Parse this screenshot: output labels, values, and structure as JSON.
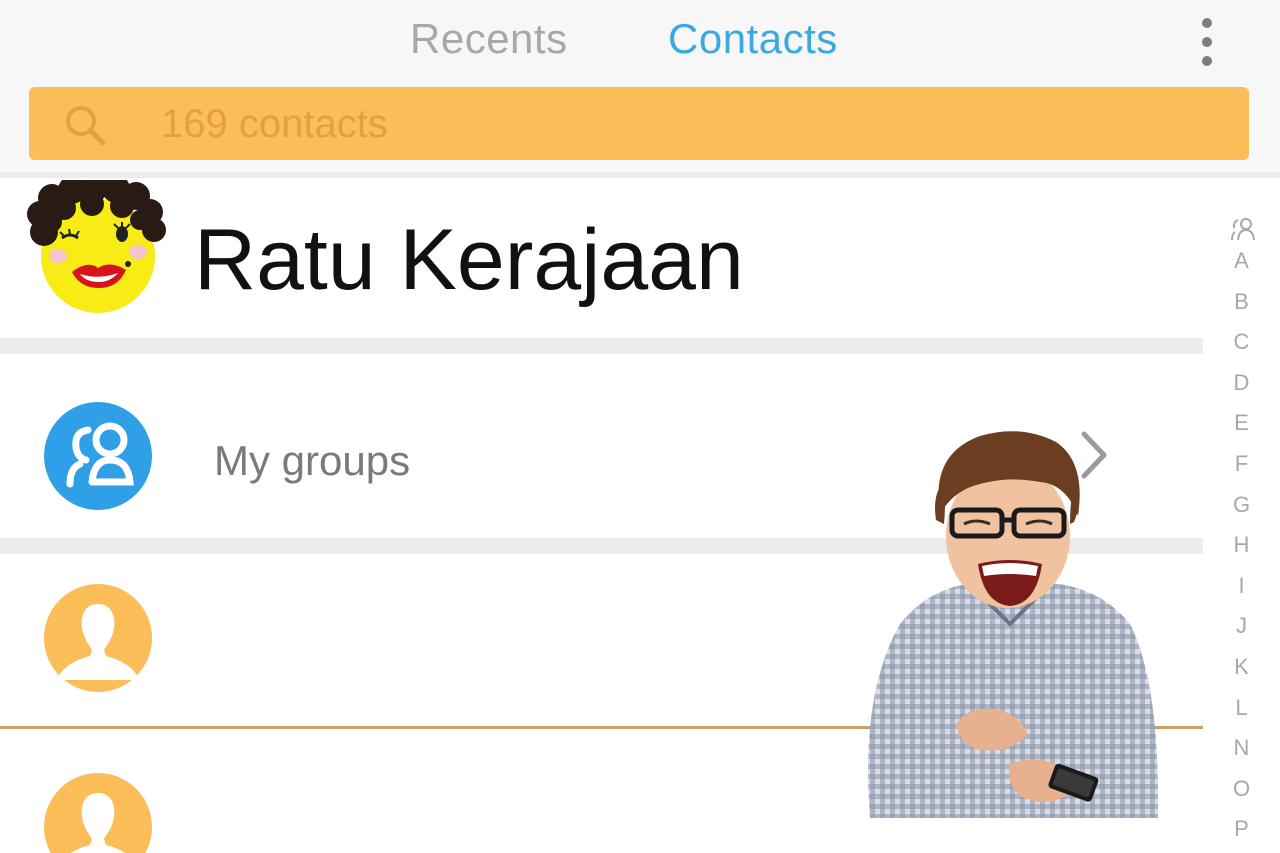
{
  "tabs": {
    "recents": "Recents",
    "contacts": "Contacts",
    "active": "Contacts",
    "active_color": "#3aa9e2",
    "inactive_color": "#a8a8a8"
  },
  "menu_icon": "more-vertical-icon",
  "search": {
    "placeholder": "169 contacts",
    "icon": "search-icon",
    "bar_color": "#fbbd57"
  },
  "profile": {
    "name": "Ratu Kerajaan",
    "avatar": "cartoon-face-avatar"
  },
  "groups": {
    "label": "My groups",
    "icon": "groups-icon",
    "icon_color": "#2f9fe8",
    "chevron": "chevron-right-icon"
  },
  "contacts": [
    {
      "avatar": "person-placeholder-icon",
      "color": "#fbbd57"
    },
    {
      "avatar": "person-placeholder-icon",
      "color": "#fbbd57"
    }
  ],
  "alphabet_index": {
    "groups_icon": "groups-small-icon",
    "letters": [
      "A",
      "B",
      "C",
      "D",
      "E",
      "F",
      "G",
      "H",
      "I",
      "J",
      "K",
      "L",
      "N",
      "O",
      "P"
    ]
  },
  "overlay": {
    "sticker": "laughing-man-with-phone-image"
  }
}
